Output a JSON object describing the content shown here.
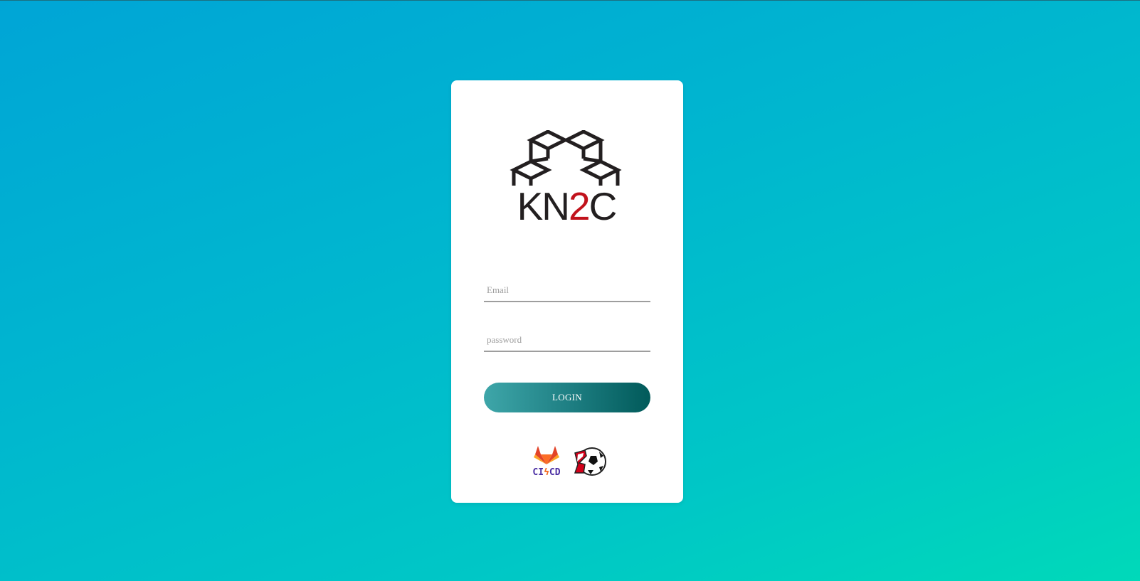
{
  "brand": {
    "logo_text_prefix": "KN",
    "logo_text_accent": "2",
    "logo_text_suffix": "C",
    "accent_color": "#c1121c"
  },
  "form": {
    "email_placeholder": "Email",
    "password_placeholder": "password",
    "login_label": "LOGIN"
  },
  "footer": {
    "cicd_prefix": "CI",
    "cicd_bolt": "ϟ",
    "cicd_suffix": "CD",
    "icons": [
      "gitlab-fox-icon",
      "robocup-soccer-ball-icon"
    ]
  },
  "theme": {
    "background_start": "#00a5d6",
    "background_end": "#00d9b9",
    "button_start": "#3ea6a9",
    "button_end": "#015a5a"
  }
}
